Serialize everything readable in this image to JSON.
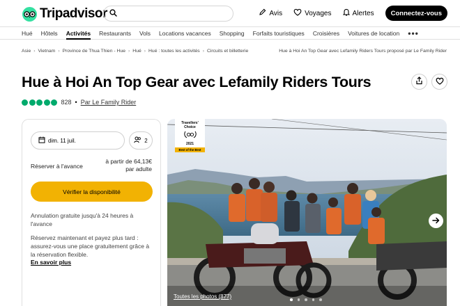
{
  "header": {
    "brand": "Tripadvisor",
    "search_placeholder": "",
    "nav": [
      {
        "label": "Avis",
        "icon": "pen-icon"
      },
      {
        "label": "Voyages",
        "icon": "heart-icon"
      },
      {
        "label": "Alertes",
        "icon": "bell-icon"
      }
    ],
    "connect_label": "Connectez-vous"
  },
  "subnav": {
    "items": [
      "Hué",
      "Hôtels",
      "Activités",
      "Restaurants",
      "Vols",
      "Locations vacances",
      "Shopping",
      "Forfaits touristiques",
      "Croisières",
      "Voitures de location"
    ],
    "active": "Activités",
    "more": "•••"
  },
  "breadcrumb": {
    "items": [
      "Asie",
      "Vietnam",
      "Province de Thua Thien - Hue",
      "Hué",
      "Hué : toutes les activités",
      "Circuits et billetterie"
    ],
    "current": "Hue à Hoi An Top Gear avec Lefamily Riders Tours proposé par Le Family Rider"
  },
  "product": {
    "title": "Hue à Hoi An Top Gear avec Lefamily Riders Tours",
    "rating_bubbles": 5,
    "review_count": "828",
    "by_label": "Par Le Family Rider"
  },
  "booking": {
    "date": "dim. 11 juil.",
    "people": "2",
    "reserve_label": "Réserver à l'avance",
    "price_line1": "à partir de 64,13€",
    "price_line2": "par adulte",
    "check_button": "Vérifier la disponibilité",
    "cancel_text": "Annulation gratuite jusqu'à 24 heures à l'avance",
    "pay_text": "Réservez maintenant et payez plus tard : assurez-vous une place gratuitement grâce à la réservation flexible.",
    "learn_more": "En savoir plus"
  },
  "photo": {
    "award_line1": "Travellers'",
    "award_line2": "Choice",
    "award_year": "2021",
    "award_band": "Best of the Best",
    "all_photos": "Toutes les photos (877)",
    "dot_count": 5,
    "active_dot": 0
  },
  "colors": {
    "brand_green": "#34e0a1",
    "rating_green": "#00aa6c",
    "cta_yellow": "#f2b203"
  }
}
